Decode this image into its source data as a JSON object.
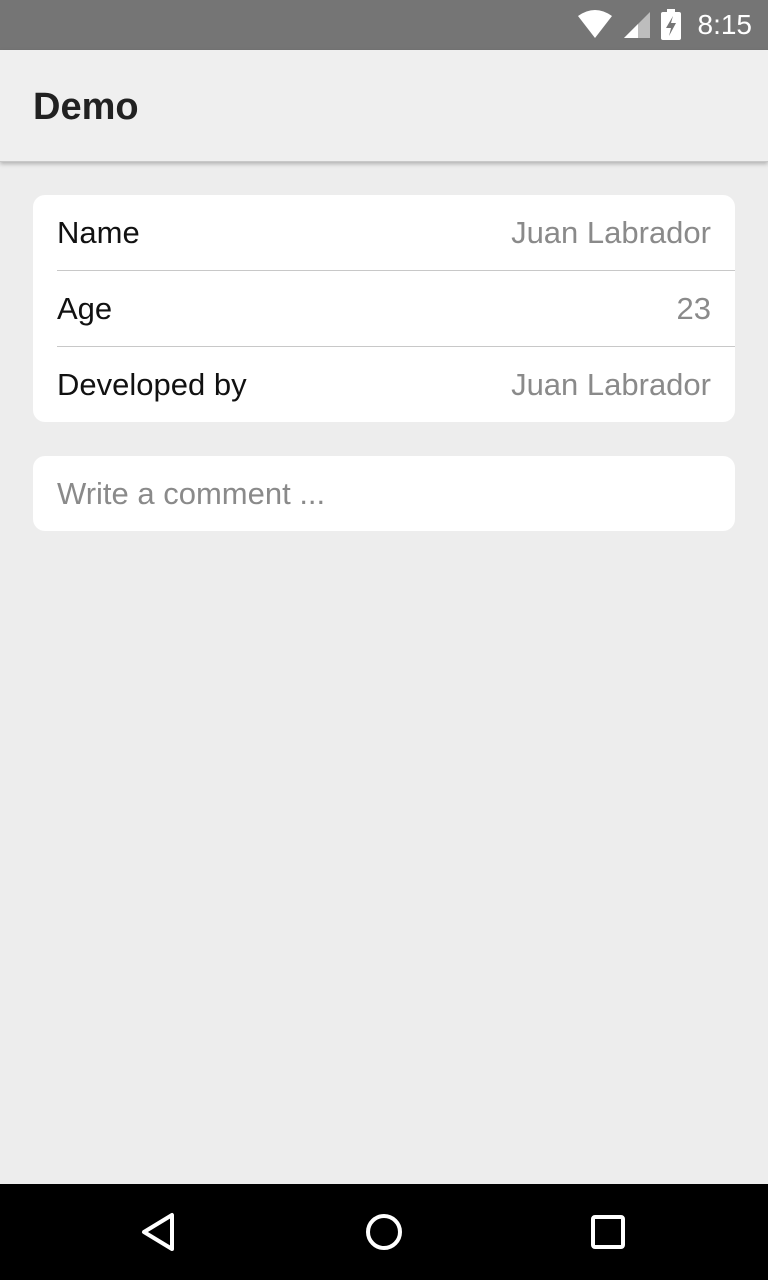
{
  "status_bar": {
    "time": "8:15"
  },
  "app_bar": {
    "title": "Demo"
  },
  "details": [
    {
      "label": "Name",
      "value": "Juan Labrador"
    },
    {
      "label": "Age",
      "value": "23"
    },
    {
      "label": "Developed by",
      "value": "Juan Labrador"
    }
  ],
  "comment": {
    "placeholder": "Write a comment ...",
    "value": ""
  },
  "nav_bar": {
    "icons": [
      "back-icon",
      "home-icon",
      "recents-icon"
    ]
  }
}
